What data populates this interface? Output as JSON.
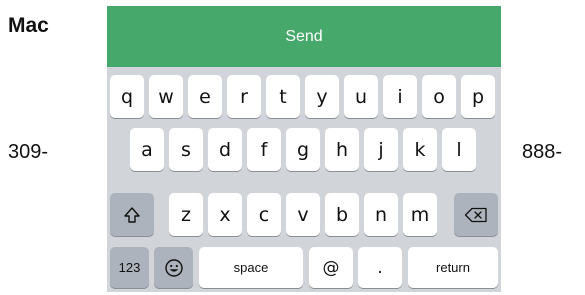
{
  "brand": "Mac",
  "left_number": "309-",
  "right_number": "888-",
  "send_label": "Send",
  "keyboard": {
    "row1": [
      "q",
      "w",
      "e",
      "r",
      "t",
      "y",
      "u",
      "i",
      "o",
      "p"
    ],
    "row2": [
      "a",
      "s",
      "d",
      "f",
      "g",
      "h",
      "j",
      "k",
      "l"
    ],
    "row3": [
      "z",
      "x",
      "c",
      "v",
      "b",
      "n",
      "m"
    ],
    "numbers_key": "123",
    "space_key": "space",
    "at_key": "@",
    "period_key": ".",
    "return_key": "return",
    "icons": {
      "shift": "shift-icon",
      "backspace": "backspace-icon",
      "emoji": "emoji-icon"
    }
  },
  "colors": {
    "send_bar": "#46a86a",
    "keyboard_bg": "#d1d4d9",
    "key_light": "#ffffff",
    "key_dark": "#adb3bc"
  }
}
